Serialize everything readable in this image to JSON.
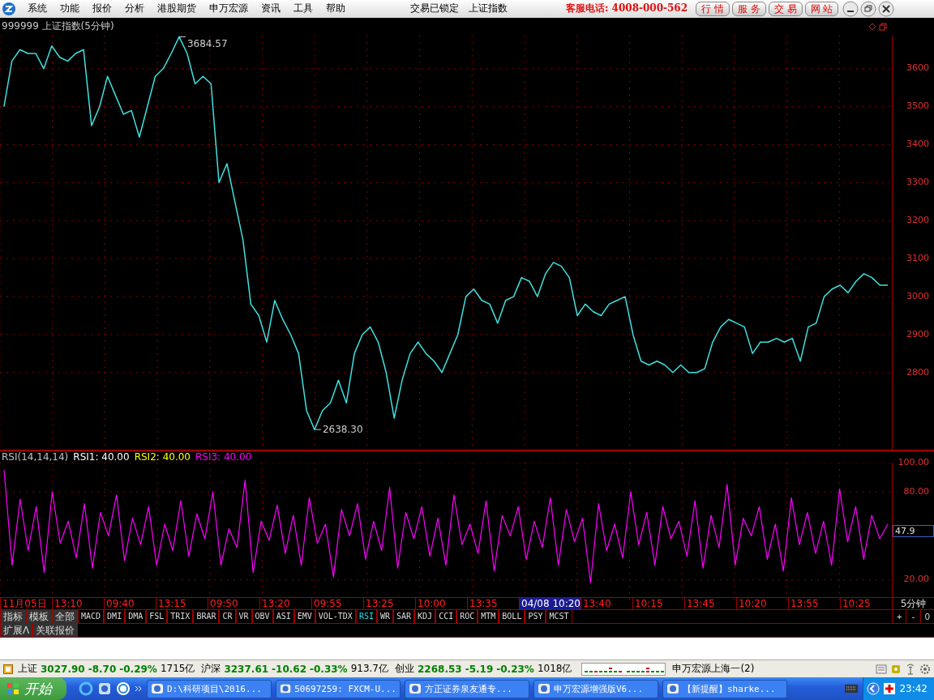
{
  "menu_bar": {
    "items": [
      "系统",
      "功能",
      "报价",
      "分析",
      "港股期货",
      "申万宏源",
      "资讯",
      "工具",
      "帮助"
    ],
    "lock_status": "交易已锁定",
    "current_symbol": "上证指数",
    "hotline": "客服电话: 4008-000-562",
    "quick_buttons": [
      "行 情",
      "服 务",
      "交 易",
      "网 站"
    ]
  },
  "price_pane": {
    "title": "999999 上证指数(5分钟)",
    "chart_data": {
      "type": "line",
      "ylim": [
        2597,
        3687
      ],
      "yticks": [
        2800,
        2900,
        3000,
        3100,
        3200,
        3300,
        3400,
        3500,
        3600
      ],
      "series": [
        {
          "color": "#40e0e0",
          "values": [
            3500,
            3620,
            3650,
            3640,
            3640,
            3600,
            3660,
            3630,
            3620,
            3640,
            3650,
            3450,
            3500,
            3580,
            3530,
            3480,
            3490,
            3420,
            3500,
            3580,
            3600,
            3640,
            3684,
            3640,
            3560,
            3580,
            3560,
            3300,
            3350,
            3250,
            3150,
            2980,
            2950,
            2880,
            2990,
            2940,
            2900,
            2850,
            2700,
            2650,
            2700,
            2720,
            2780,
            2720,
            2850,
            2900,
            2920,
            2880,
            2800,
            2680,
            2780,
            2850,
            2880,
            2850,
            2830,
            2800,
            2850,
            2900,
            3000,
            3020,
            2990,
            2980,
            2930,
            2990,
            3000,
            3050,
            3040,
            3000,
            3060,
            3090,
            3080,
            3050,
            2950,
            2980,
            2960,
            2950,
            2980,
            2990,
            3000,
            2900,
            2830,
            2820,
            2830,
            2820,
            2800,
            2820,
            2800,
            2800,
            2810,
            2880,
            2920,
            2940,
            2930,
            2920,
            2850,
            2880,
            2880,
            2890,
            2880,
            2890,
            2830,
            2920,
            2930,
            3000,
            3020,
            3030,
            3010,
            3040,
            3060,
            3050,
            3030,
            3030
          ]
        }
      ],
      "grid": true,
      "annotations": [
        "3684.57",
        "2638.30"
      ]
    }
  },
  "rsi_pane": {
    "legend": [
      {
        "text": "RSI(14,14,14)",
        "color": "#c0c0c0"
      },
      {
        "text": "RSI1: 40.00",
        "color": "#ffffff"
      },
      {
        "text": "RSI2: 40.00",
        "color": "#ffff00"
      },
      {
        "text": "RSI3: 40.00",
        "color": "#ff00ff"
      }
    ],
    "current_value": "47.9",
    "chart_data": {
      "type": "line",
      "grid": true,
      "ylim": [
        6,
        100
      ],
      "yticks": [
        {
          "value": 20,
          "label": "20.00"
        },
        {
          "value": 80,
          "label": "80.00"
        },
        {
          "value": 100,
          "label": "100.00"
        }
      ],
      "series": [
        {
          "color": "#ff00ff",
          "values": [
            95,
            30,
            75,
            40,
            70,
            25,
            80,
            45,
            60,
            35,
            72,
            28,
            66,
            50,
            78,
            33,
            62,
            44,
            70,
            30,
            58,
            40,
            74,
            36,
            65,
            48,
            80,
            30,
            55,
            42,
            88,
            25,
            60,
            47,
            71,
            38,
            64,
            30,
            76,
            45,
            58,
            22,
            68,
            50,
            72,
            34,
            60,
            40,
            83,
            28,
            66,
            48,
            70,
            36,
            62,
            30,
            78,
            44,
            58,
            38,
            74,
            26,
            64,
            50,
            70,
            34,
            60,
            42,
            76,
            30,
            68,
            46,
            62,
            18,
            72,
            40,
            58,
            35,
            80,
            44,
            66,
            30,
            70,
            48,
            60,
            36,
            74,
            28,
            64,
            42,
            85,
            30,
            62,
            50,
            70,
            34,
            58,
            26,
            76,
            44,
            66,
            38,
            60,
            30,
            82,
            46,
            70,
            34,
            64,
            48,
            58
          ]
        }
      ]
    }
  },
  "time_axis": {
    "labels": [
      {
        "text": "11月05日",
        "selected": false
      },
      {
        "text": "13:10",
        "selected": false
      },
      {
        "text": "09:40",
        "selected": false
      },
      {
        "text": "13:15",
        "selected": false
      },
      {
        "text": "09:50",
        "selected": false
      },
      {
        "text": "13:20",
        "selected": false
      },
      {
        "text": "09:55",
        "selected": false
      },
      {
        "text": "13:25",
        "selected": false
      },
      {
        "text": "10:00",
        "selected": false
      },
      {
        "text": "13:35",
        "selected": false
      },
      {
        "text": "04/08 10:20",
        "selected": true
      },
      {
        "text": "13:40",
        "selected": false
      },
      {
        "text": "10:15",
        "selected": false
      },
      {
        "text": "13:45",
        "selected": false
      },
      {
        "text": "10:20",
        "selected": false
      },
      {
        "text": "13:55",
        "selected": false
      },
      {
        "text": "10:25",
        "selected": false
      }
    ],
    "period": "5分钟"
  },
  "indicator_tabs": [
    {
      "label": "指标",
      "selected": false
    },
    {
      "label": "模板",
      "selected": false
    },
    {
      "label": "全部",
      "selected": false
    },
    {
      "label": "MACD",
      "selected": false
    },
    {
      "label": "DMI",
      "selected": false
    },
    {
      "label": "DMA",
      "selected": false
    },
    {
      "label": "FSL",
      "selected": false
    },
    {
      "label": "TRIX",
      "selected": false
    },
    {
      "label": "BRAR",
      "selected": false
    },
    {
      "label": "CR",
      "selected": false
    },
    {
      "label": "VR",
      "selected": false
    },
    {
      "label": "OBV",
      "selected": false
    },
    {
      "label": "ASI",
      "selected": false
    },
    {
      "label": "EMV",
      "selected": false
    },
    {
      "label": "VOL-TDX",
      "selected": false
    },
    {
      "label": "RSI",
      "selected": true
    },
    {
      "label": "WR",
      "selected": false
    },
    {
      "label": "SAR",
      "selected": false
    },
    {
      "label": "KDJ",
      "selected": false
    },
    {
      "label": "CCI",
      "selected": false
    },
    {
      "label": "ROC",
      "selected": false
    },
    {
      "label": "MTM",
      "selected": false
    },
    {
      "label": "BOLL",
      "selected": false
    },
    {
      "label": "PSY",
      "selected": false
    },
    {
      "label": "MCST",
      "selected": false
    }
  ],
  "zoom_buttons": [
    "+",
    "-",
    "0"
  ],
  "extra_tabs": [
    "扩展Λ",
    "关联报价"
  ],
  "status_bar": {
    "indices": [
      {
        "name": "上证",
        "price": "3027.90",
        "change": "-8.70",
        "percent": "-0.29%",
        "volume": "1715亿"
      },
      {
        "name": "沪深",
        "price": "3237.61",
        "change": "-10.62",
        "percent": "-0.33%",
        "volume": "913.7亿"
      },
      {
        "name": "创业",
        "price": "2268.53",
        "change": "-5.19",
        "percent": "-0.23%",
        "volume": "1018亿"
      }
    ],
    "server": "申万宏源上海一(2)"
  },
  "taskbar": {
    "start": "开始",
    "tasks": [
      "D:\\科研项目\\2016...",
      "50697259: FXCM-U...",
      "方正证券泉友通专...",
      "申万宏源增强版V6...",
      "【新提醒】sharke..."
    ],
    "clock": "23:42"
  }
}
